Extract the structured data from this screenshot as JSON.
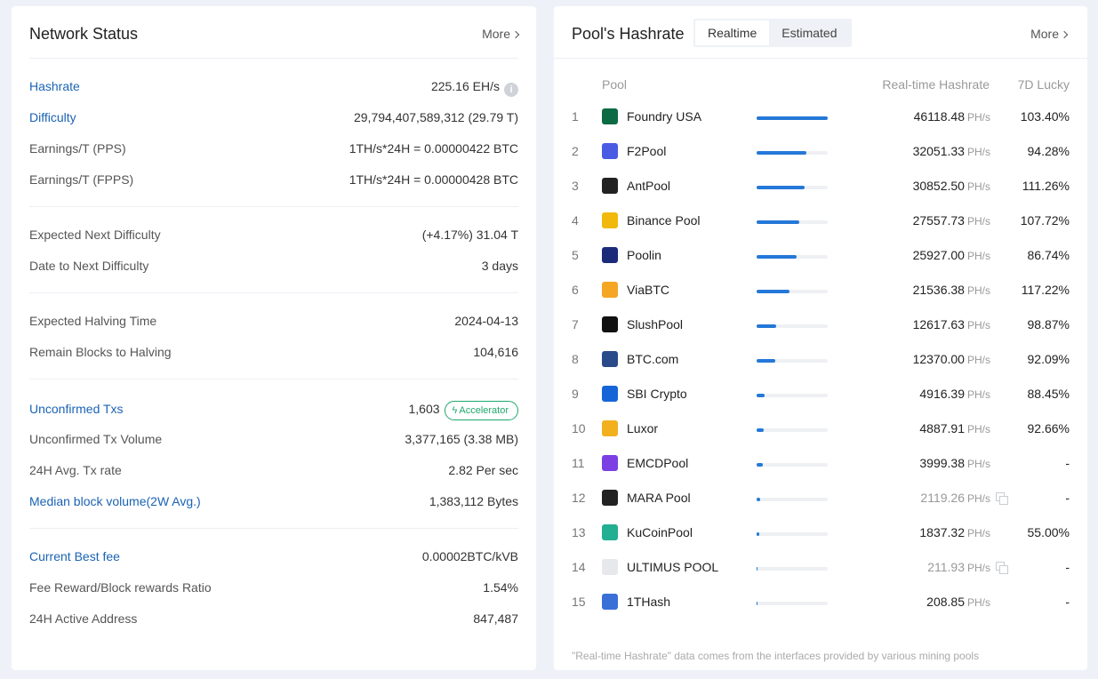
{
  "network": {
    "title": "Network Status",
    "more_label": "More",
    "rows": [
      {
        "label": "Hashrate",
        "value": "225.16 EH/s",
        "link": true
      },
      {
        "label": "Difficulty",
        "value": "29,794,407,589,312 (29.79 T)",
        "link": true
      },
      {
        "label": "Earnings/T (PPS)",
        "value": "1TH/s*24H = 0.00000422 BTC",
        "link": false
      },
      {
        "label": "Earnings/T (FPPS)",
        "value": "1TH/s*24H = 0.00000428 BTC",
        "link": false
      },
      {
        "label": "Expected Next Difficulty",
        "value": "(+4.17%) 31.04 T",
        "link": false
      },
      {
        "label": "Date to Next Difficulty",
        "value": "3 days",
        "link": false
      },
      {
        "label": "Expected Halving Time",
        "value": "2024-04-13",
        "link": false
      },
      {
        "label": "Remain Blocks to Halving",
        "value": "104,616",
        "link": false
      },
      {
        "label": "Unconfirmed Txs",
        "value": "1,603",
        "link": true
      },
      {
        "label": "Unconfirmed Tx Volume",
        "value": "3,377,165 (3.38 MB)",
        "link": false
      },
      {
        "label": "24H Avg. Tx rate",
        "value": "2.82 Per sec",
        "link": false
      },
      {
        "label": "Median block volume(2W Avg.)",
        "value": "1,383,112 Bytes",
        "link": true
      },
      {
        "label": "Current Best fee",
        "value": "0.00002BTC/kVB",
        "link": true
      },
      {
        "label": "Fee Reward/Block rewards Ratio",
        "value": "1.54%",
        "link": false
      },
      {
        "label": "24H Active Address",
        "value": "847,487",
        "link": false
      }
    ],
    "info_glyph": "i",
    "accelerator_label": "Accelerator"
  },
  "pools": {
    "title": "Pool's Hashrate",
    "more_label": "More",
    "tabs": [
      "Realtime",
      "Estimated"
    ],
    "active_tab": 0,
    "headers": {
      "pool": "Pool",
      "hashrate": "Real-time Hashrate",
      "lucky": "7D Lucky"
    },
    "unit": "PH/s",
    "rows": [
      {
        "rank": "1",
        "name": "Foundry USA",
        "hashrate": "46118.48",
        "lucky": "103.40%",
        "share": 1.0,
        "color": "#0d6b43",
        "muted": false,
        "icon": "foundry-icon"
      },
      {
        "rank": "2",
        "name": "F2Pool",
        "hashrate": "32051.33",
        "lucky": "94.28%",
        "share": 0.695,
        "color": "#4a5be3",
        "muted": false,
        "icon": "f2pool-icon"
      },
      {
        "rank": "3",
        "name": "AntPool",
        "hashrate": "30852.50",
        "lucky": "111.26%",
        "share": 0.669,
        "color": "#222222",
        "muted": false,
        "icon": "antpool-icon"
      },
      {
        "rank": "4",
        "name": "Binance Pool",
        "hashrate": "27557.73",
        "lucky": "107.72%",
        "share": 0.598,
        "color": "#f0b90b",
        "muted": false,
        "icon": "binance-icon"
      },
      {
        "rank": "5",
        "name": "Poolin",
        "hashrate": "25927.00",
        "lucky": "86.74%",
        "share": 0.562,
        "color": "#1c2a7a",
        "muted": false,
        "icon": "poolin-icon"
      },
      {
        "rank": "6",
        "name": "ViaBTC",
        "hashrate": "21536.38",
        "lucky": "117.22%",
        "share": 0.467,
        "color": "#f5a623",
        "muted": false,
        "icon": "viabtc-icon"
      },
      {
        "rank": "7",
        "name": "SlushPool",
        "hashrate": "12617.63",
        "lucky": "98.87%",
        "share": 0.274,
        "color": "#111111",
        "muted": false,
        "icon": "slushpool-icon"
      },
      {
        "rank": "8",
        "name": "BTC.com",
        "hashrate": "12370.00",
        "lucky": "92.09%",
        "share": 0.268,
        "color": "#2b4a8a",
        "muted": false,
        "icon": "btccom-icon"
      },
      {
        "rank": "9",
        "name": "SBI Crypto",
        "hashrate": "4916.39",
        "lucky": "88.45%",
        "share": 0.107,
        "color": "#1565d8",
        "muted": false,
        "icon": "sbi-crypto-icon"
      },
      {
        "rank": "10",
        "name": "Luxor",
        "hashrate": "4887.91",
        "lucky": "92.66%",
        "share": 0.106,
        "color": "#f2b01e",
        "muted": false,
        "icon": "luxor-icon"
      },
      {
        "rank": "11",
        "name": "EMCDPool",
        "hashrate": "3999.38",
        "lucky": "-",
        "share": 0.087,
        "color": "#7b3fe4",
        "muted": false,
        "icon": "emcdpool-icon"
      },
      {
        "rank": "12",
        "name": "MARA Pool",
        "hashrate": "2119.26",
        "lucky": "-",
        "share": 0.046,
        "color": "#222222",
        "muted": true,
        "icon": "mara-pool-icon"
      },
      {
        "rank": "13",
        "name": "KuCoinPool",
        "hashrate": "1837.32",
        "lucky": "55.00%",
        "share": 0.04,
        "color": "#23af91",
        "muted": false,
        "icon": "kucoinpool-icon"
      },
      {
        "rank": "14",
        "name": "ULTIMUS POOL",
        "hashrate": "211.93",
        "lucky": "-",
        "share": 0.005,
        "color": "#e6e8ec",
        "muted": true,
        "icon": "ultimus-pool-icon"
      },
      {
        "rank": "15",
        "name": "1THash",
        "hashrate": "208.85",
        "lucky": "-",
        "share": 0.005,
        "color": "#3b6fd8",
        "muted": false,
        "icon": "1thash-icon"
      }
    ],
    "footnote": "\"Real-time Hashrate\" data comes from the interfaces provided by various mining pools"
  }
}
